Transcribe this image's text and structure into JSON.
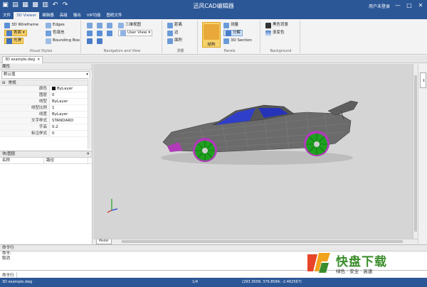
{
  "window": {
    "title": "迅风CAD编辑器",
    "login": "用户未登录",
    "controls": [
      "minimize",
      "maximize",
      "close"
    ]
  },
  "quick_access": [
    "new-icon",
    "open-icon",
    "print-icon",
    "save-icon",
    "print-preview-icon",
    "undo-icon",
    "redo-icon"
  ],
  "tabs": [
    "文件",
    "3D Viewer",
    "编辑器",
    "高级",
    "输出",
    "VIP功能",
    "图纸文件"
  ],
  "ribbon": {
    "visual_styles": {
      "title": "Visual Styles",
      "wireframe": "3D Wireframe",
      "edges": "Edges",
      "surface": "表面",
      "color_fill": "色填充",
      "smooth": "光滑",
      "bounding_box": "Bounding Box"
    },
    "navigation": {
      "title": "Navigation and View",
      "view_front": "三维视图",
      "user_view": "User View"
    },
    "measure": {
      "title": "测量",
      "distance": "距离",
      "edge": "边",
      "area": "面积"
    },
    "panels": {
      "title": "Panels",
      "structure": "结构",
      "properties": "测量",
      "explode": "分解",
      "section": "3D Section"
    },
    "background": {
      "title": "Background",
      "black_bg": "黑色背景",
      "gradient": "渐变色"
    }
  },
  "document_tab": {
    "label": "3D example.dwg"
  },
  "properties_panel": {
    "title": "属性",
    "combo_value": "默认值",
    "section": "常规",
    "rows": [
      {
        "k": "颜色",
        "v": "ByLayer",
        "swatch": true
      },
      {
        "k": "图层",
        "v": "0"
      },
      {
        "k": "线型",
        "v": "ByLayer"
      },
      {
        "k": "线型比例",
        "v": "1"
      },
      {
        "k": "线宽",
        "v": "ByLayer"
      },
      {
        "k": "文字样式",
        "v": "STANDARD"
      },
      {
        "k": "字高",
        "v": "0.2"
      },
      {
        "k": "标注样式",
        "v": "0"
      }
    ]
  },
  "layers_panel": {
    "title": "块/图层",
    "columns": [
      "名称",
      "路径"
    ]
  },
  "viewport": {
    "model_tab": "Model"
  },
  "command_area": {
    "title": "命令行",
    "lines": [
      "命令:",
      "取消"
    ],
    "input_label": "命令行"
  },
  "status": {
    "file": "3D example.dwg",
    "page": "1/4",
    "coords": "(293.3509; 376.8584; -2.462567)"
  },
  "watermark": {
    "title": "快盘下载",
    "subtitle": "绿色 · 安全 · 高速"
  },
  "colors": {
    "accent": "#2b5797",
    "car_body": "#6b6b6b",
    "car_glass": "#2f3fc9",
    "car_wheel": "#1fa020",
    "car_accent": "#b03ab8"
  }
}
